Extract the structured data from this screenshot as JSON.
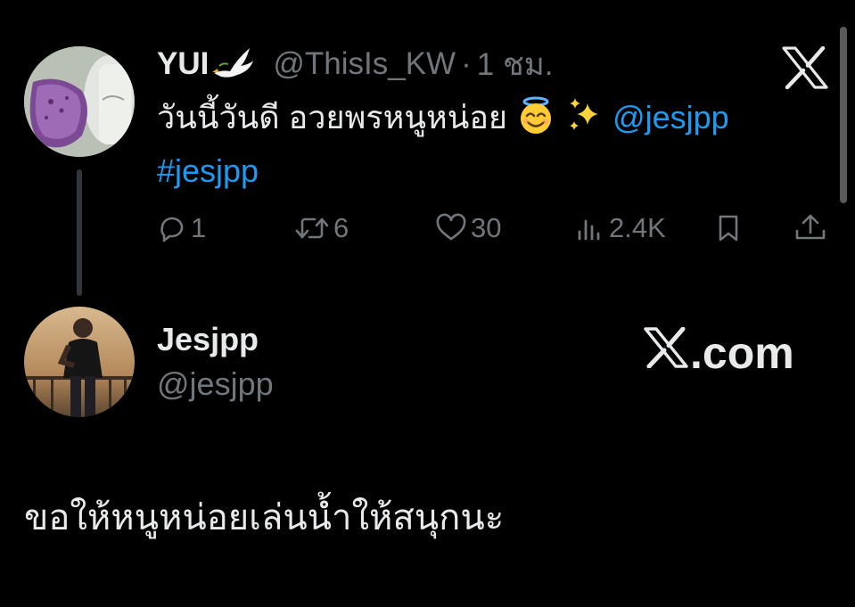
{
  "tweet": {
    "author_name": "YUI",
    "author_emoji": "🕊️",
    "handle": "@ThisIs_KW",
    "separator": "·",
    "time": "1 ชม.",
    "text_part1": "วันนี้วันดี อวยพรหนูหน่อย",
    "emoji_halo": "😇",
    "emoji_sparkles": "✨",
    "mention": "@jesjpp",
    "hashtag": "#jesjpp",
    "stats": {
      "replies": "1",
      "retweets": "6",
      "likes": "30",
      "views": "2.4K"
    }
  },
  "profile": {
    "name": "Jesjpp",
    "handle": "@jesjpp"
  },
  "watermark": {
    "text": ".com",
    "logo_icon": "x-logo-icon"
  },
  "reply_text": "ขอให้หนูหน่อยเล่นน้ำให้สนุกนะ",
  "icons": {
    "reply": "reply-icon",
    "retweet": "retweet-icon",
    "like": "heart-icon",
    "views": "views-icon",
    "bookmark": "bookmark-icon",
    "share": "share-icon",
    "brand": "x-logo-icon"
  },
  "colors": {
    "background": "#000000",
    "text_primary": "#e7e9ea",
    "text_secondary": "#71767b",
    "link": "#1d9bf0",
    "thread_line": "#333639"
  }
}
